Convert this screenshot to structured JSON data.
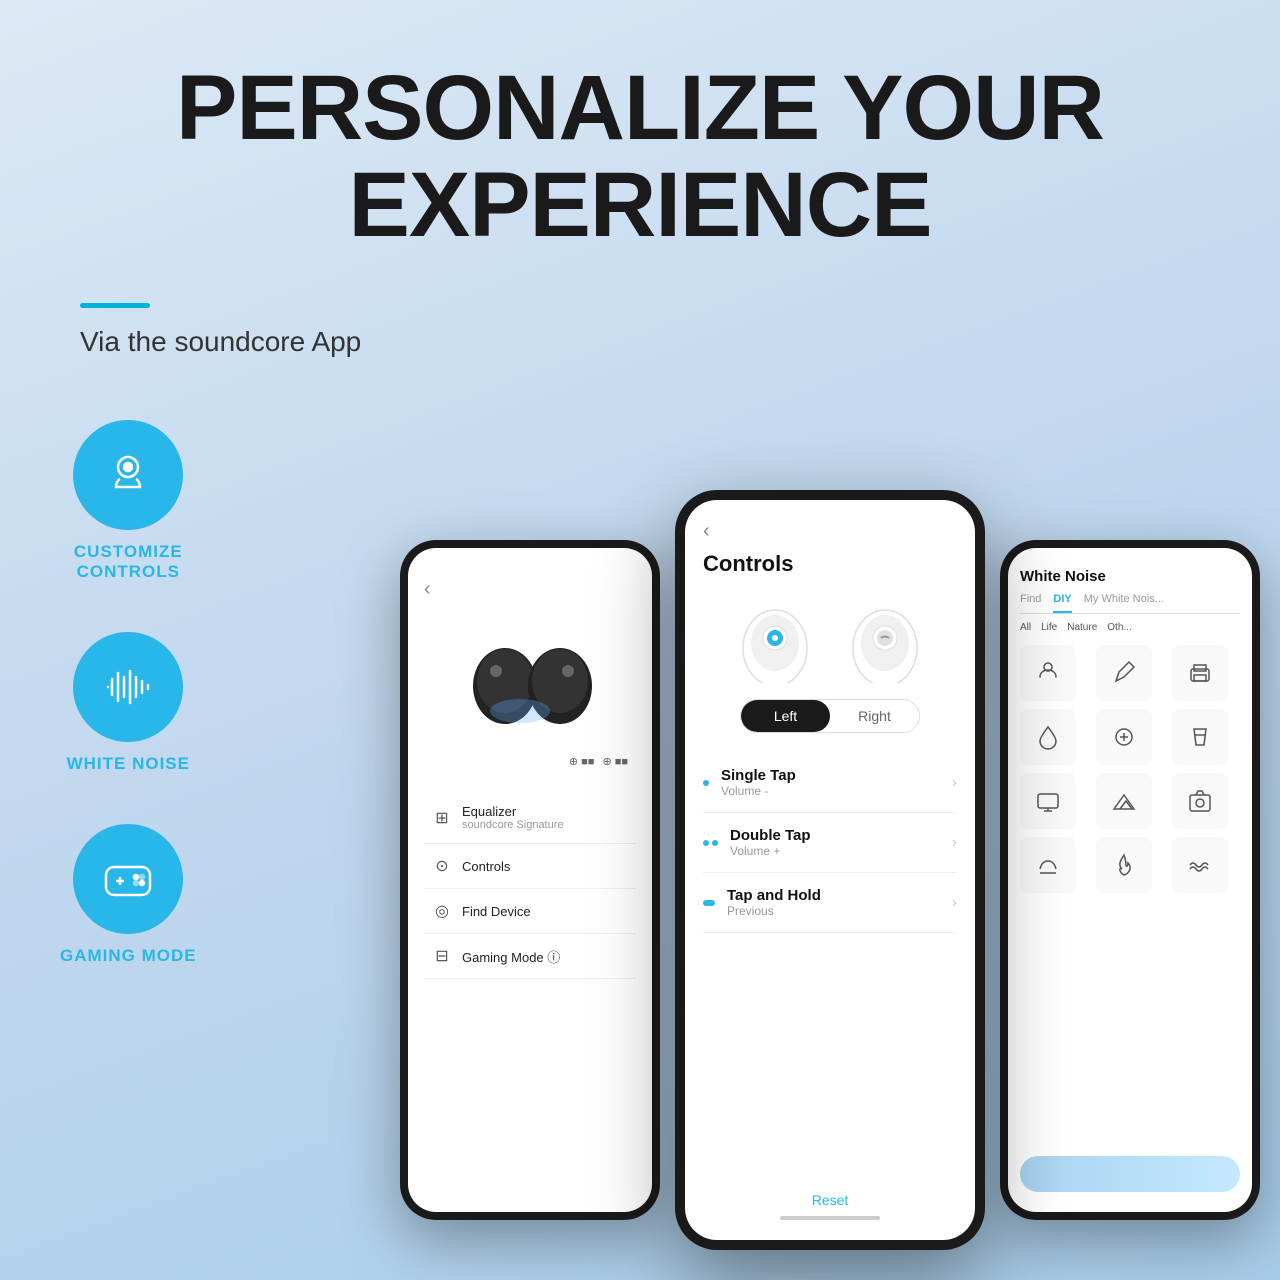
{
  "header": {
    "title_line1": "PERSONALIZE YOUR",
    "title_line2": "EXPERIENCE",
    "subtitle": "Via the soundcore App"
  },
  "accent_line": true,
  "features": [
    {
      "id": "customize-controls",
      "label": "CUSTOMIZE\nCONTROLS",
      "icon": "touch-icon"
    },
    {
      "id": "white-noise",
      "label": "WHITE NOISE",
      "icon": "waveform-icon"
    },
    {
      "id": "gaming-mode",
      "label": "GAMING MODE",
      "icon": "gamepad-icon"
    }
  ],
  "phone_left": {
    "menu_items": [
      {
        "icon": "equalizer",
        "label": "Equalizer",
        "sublabel": "soundcore Signature"
      },
      {
        "icon": "controls",
        "label": "Controls",
        "sublabel": ""
      },
      {
        "icon": "find",
        "label": "Find Device",
        "sublabel": ""
      },
      {
        "icon": "gaming",
        "label": "Gaming Mode",
        "sublabel": ""
      }
    ]
  },
  "phone_center": {
    "back_label": "‹",
    "title": "Controls",
    "left_tab": "Left",
    "right_tab": "Right",
    "controls": [
      {
        "type": "single",
        "label": "Single Tap",
        "sublabel": "Volume -"
      },
      {
        "type": "double",
        "label": "Double Tap",
        "sublabel": "Volume +"
      },
      {
        "type": "hold",
        "label": "Tap and Hold",
        "sublabel": "Previous"
      }
    ],
    "reset_label": "Reset"
  },
  "phone_right": {
    "title": "White Noise",
    "tabs": [
      {
        "label": "Find",
        "active": false
      },
      {
        "label": "DIY",
        "active": true
      },
      {
        "label": "My White Nois...",
        "active": false
      }
    ],
    "categories": [
      "All",
      "Life",
      "Nature",
      "Oth..."
    ]
  },
  "colors": {
    "accent": "#29b6e8",
    "dark": "#1a1a1a",
    "light_bg": "#f5f5f7"
  }
}
